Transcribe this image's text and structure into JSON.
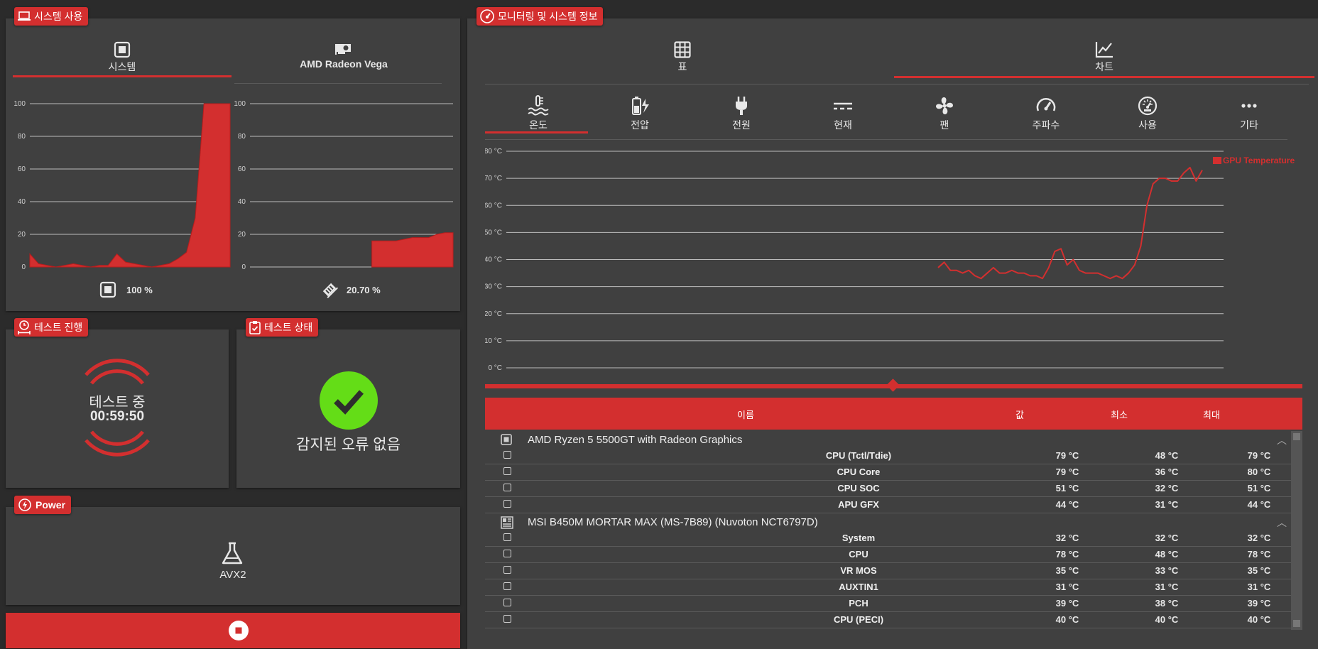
{
  "system_usage": {
    "title": "시스템 사용",
    "tabs": [
      {
        "label": "시스템",
        "icon": "cpu-icon",
        "active": true
      },
      {
        "label": "AMD Radeon Vega",
        "icon": "gpu-icon",
        "active": false
      }
    ],
    "cpu_value": "100 %",
    "gpu_value": "20.70 %",
    "y_ticks": [
      "100",
      "80",
      "60",
      "40",
      "20",
      "0"
    ]
  },
  "test_progress": {
    "title": "테스트 진행",
    "status": "테스트 중",
    "elapsed": "00:59:50"
  },
  "test_status": {
    "title": "테스트 상태",
    "message": "감지된 오류 없음",
    "accent": "#64dd17"
  },
  "power": {
    "title": "Power",
    "mode": "AVX2"
  },
  "monitoring": {
    "title": "모니터링 및 시스템 정보",
    "view_tabs": [
      {
        "label": "표",
        "icon": "table-icon",
        "active": false
      },
      {
        "label": "차트",
        "icon": "line-chart-icon",
        "active": true
      }
    ],
    "sensor_tabs": [
      {
        "label": "온도",
        "icon": "thermometer-icon",
        "active": true
      },
      {
        "label": "전압",
        "icon": "battery-charging-icon",
        "active": false
      },
      {
        "label": "전원",
        "icon": "plug-icon",
        "active": false
      },
      {
        "label": "현재",
        "icon": "current-icon",
        "active": false
      },
      {
        "label": "팬",
        "icon": "fan-icon",
        "active": false
      },
      {
        "label": "주파수",
        "icon": "speedometer-icon",
        "active": false
      },
      {
        "label": "사용",
        "icon": "gauge-icon",
        "active": false
      },
      {
        "label": "기타",
        "icon": "more-icon",
        "active": false
      }
    ],
    "table_headers": {
      "name": "이름",
      "value": "값",
      "min": "최소",
      "max": "최대"
    },
    "groups": [
      {
        "name": "AMD Ryzen 5 5500GT with Radeon Graphics",
        "icon": "cpu-icon",
        "rows": [
          {
            "name": "CPU (Tctl/Tdie)",
            "value": "79 °C",
            "min": "48 °C",
            "max": "79 °C"
          },
          {
            "name": "CPU Core",
            "value": "79 °C",
            "min": "36 °C",
            "max": "80 °C"
          },
          {
            "name": "CPU SOC",
            "value": "51 °C",
            "min": "32 °C",
            "max": "51 °C"
          },
          {
            "name": "APU GFX",
            "value": "44 °C",
            "min": "31 °C",
            "max": "44 °C"
          }
        ]
      },
      {
        "name": "MSI B450M MORTAR MAX (MS-7B89) (Nuvoton NCT6797D)",
        "icon": "motherboard-icon",
        "rows": [
          {
            "name": "System",
            "value": "32 °C",
            "min": "32 °C",
            "max": "32 °C"
          },
          {
            "name": "CPU",
            "value": "78 °C",
            "min": "48 °C",
            "max": "78 °C"
          },
          {
            "name": "VR MOS",
            "value": "35 °C",
            "min": "33 °C",
            "max": "35 °C"
          },
          {
            "name": "AUXTIN1",
            "value": "31 °C",
            "min": "31 °C",
            "max": "31 °C"
          },
          {
            "name": "PCH",
            "value": "39 °C",
            "min": "38 °C",
            "max": "39 °C"
          },
          {
            "name": "CPU (PECI)",
            "value": "40 °C",
            "min": "40 °C",
            "max": "40 °C"
          }
        ]
      }
    ]
  },
  "chart_data": [
    {
      "type": "area",
      "ylim": [
        0,
        100
      ],
      "y_ticks": [
        0,
        20,
        40,
        60,
        80,
        100
      ],
      "series": [
        {
          "values": [
            8,
            2,
            1,
            0,
            1,
            2,
            1,
            0,
            1,
            1,
            8,
            3,
            2,
            1,
            0,
            1,
            2,
            5,
            9,
            30,
            100,
            100,
            100,
            100
          ]
        }
      ],
      "color": "#d32f2f"
    },
    {
      "type": "area",
      "ylim": [
        0,
        100
      ],
      "y_ticks": [
        0,
        20,
        40,
        60,
        80,
        100
      ],
      "series": [
        {
          "values": [
            null,
            null,
            null,
            null,
            null,
            null,
            null,
            null,
            null,
            null,
            null,
            null,
            null,
            null,
            null,
            16,
            16,
            16,
            16,
            17,
            18,
            18,
            18,
            20,
            21,
            21
          ]
        }
      ],
      "color": "#d32f2f"
    },
    {
      "type": "line",
      "y_unit": "°C",
      "y_ticks": [
        "0 °C",
        "10 °C",
        "20 °C",
        "30 °C",
        "40 °C",
        "50 °C",
        "60 °C",
        "70 °C",
        "80 °C"
      ],
      "ylim": [
        0,
        80
      ],
      "series": [
        {
          "name": "GPU Temperature",
          "color": "#d32f2f",
          "values": [
            37,
            39,
            36,
            36,
            35,
            36,
            34,
            33,
            35,
            37,
            35,
            35,
            36,
            35,
            35,
            34,
            34,
            33,
            37,
            43,
            44,
            38,
            40,
            36,
            35,
            35,
            35,
            34,
            33,
            34,
            33,
            35,
            38,
            45,
            60,
            68,
            70,
            70,
            69,
            69,
            72,
            74,
            69,
            73
          ]
        }
      ]
    }
  ]
}
